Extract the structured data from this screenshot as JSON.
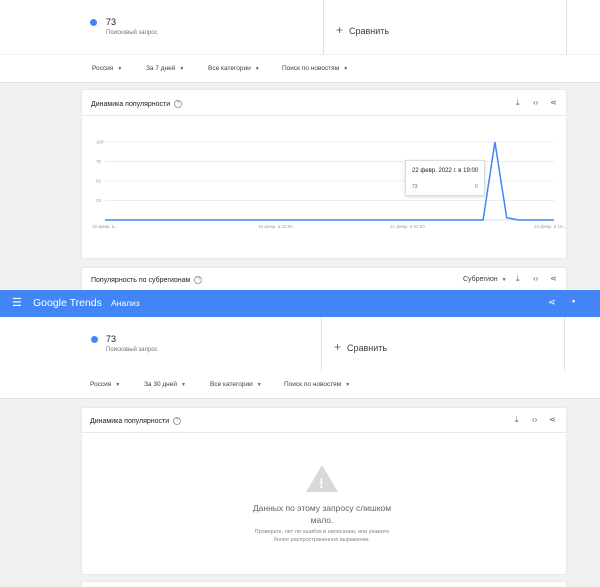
{
  "top": {
    "term": {
      "name": "73",
      "sub": "Поисковый запрос",
      "color": "#4285f4"
    },
    "compare_label": "Сравнить",
    "filters": {
      "region": "Россия",
      "period": "За 7 дней",
      "category": "Все категории",
      "search_type": "Поиск по новостям"
    },
    "panel_title": "Динамика популярности",
    "chart_data": {
      "type": "line",
      "title": "",
      "y_ticks": [
        "100",
        "75",
        "50",
        "25"
      ],
      "x_labels": [
        "16 февр. в...",
        "18 февр. в 22:00",
        "21 февр. в 04:00",
        "23 февр. в 10..."
      ],
      "ylim": [
        0,
        100
      ],
      "series": [
        {
          "name": "73",
          "values": [
            0,
            0,
            0,
            0,
            0,
            0,
            0,
            0,
            0,
            0,
            0,
            0,
            0,
            0,
            0,
            0,
            0,
            0,
            0,
            0,
            0,
            0,
            0,
            0,
            0,
            0,
            0,
            0,
            0,
            0,
            0,
            0,
            0,
            100,
            3,
            0,
            0,
            0,
            0
          ]
        }
      ],
      "tooltip": {
        "date": "22 февр. 2022 г. в 19:00",
        "term": "73",
        "value": "0"
      }
    },
    "subregion_title": "Популярность по субрегионам",
    "subregion_select": "Субрегион"
  },
  "header": {
    "logo": "Google Trends",
    "section": "Анализ",
    "color": "#4285f4"
  },
  "bottom": {
    "term": {
      "name": "73",
      "sub": "Поисковый запрос"
    },
    "compare_label": "Сравнить",
    "filters": {
      "region": "Россия",
      "period": "За 30 дней",
      "category": "Все категории",
      "search_type": "Поиск по новостям"
    },
    "panel_title": "Динамика популярности",
    "empty_message": "Данных по этому запросу слишком мало.",
    "empty_hint": "Проверьте, нет ли ошибок в написании, или укажите более распространенное выражение."
  }
}
